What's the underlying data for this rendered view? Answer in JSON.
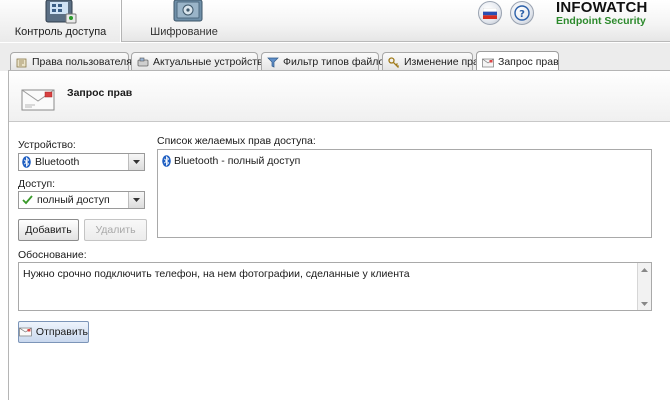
{
  "toolbar": {
    "items": [
      {
        "label": "Контроль доступа",
        "icon": "access-control-icon"
      },
      {
        "label": "Шифрование",
        "icon": "safe-icon"
      }
    ],
    "language_button": "russian-flag-icon",
    "help_button": "help-icon",
    "brand": {
      "name": "INFOWATCH",
      "sub": "Endpoint Security"
    }
  },
  "tabs": [
    {
      "label": "Права пользователя",
      "icon": "user-rights-icon"
    },
    {
      "label": "Актуальные устройства",
      "icon": "devices-icon"
    },
    {
      "label": "Фильтр типов файлов",
      "icon": "filter-icon"
    },
    {
      "label": "Изменение прав",
      "icon": "key-icon"
    },
    {
      "label": "Запрос прав",
      "icon": "envelope-icon",
      "active": true
    }
  ],
  "page": {
    "title": "Запрос прав"
  },
  "form": {
    "device_label": "Устройство:",
    "device_value": "Bluetooth",
    "access_label": "Доступ:",
    "access_value": "полный доступ",
    "add_button": "Добавить",
    "delete_button": "Удалить",
    "list_label": "Список желаемых прав доступа:",
    "list_items": [
      "Bluetooth - полный доступ"
    ],
    "reason_label": "Обоснование:",
    "reason_text": "Нужно срочно подключить телефон, на нем фотографии, сделанные у клиента",
    "send_button": "Отправить"
  },
  "colors": {
    "brand_green": "#2c8a2c",
    "bluetooth_blue": "#1f5fc2",
    "check_green": "#3a9a2a"
  }
}
